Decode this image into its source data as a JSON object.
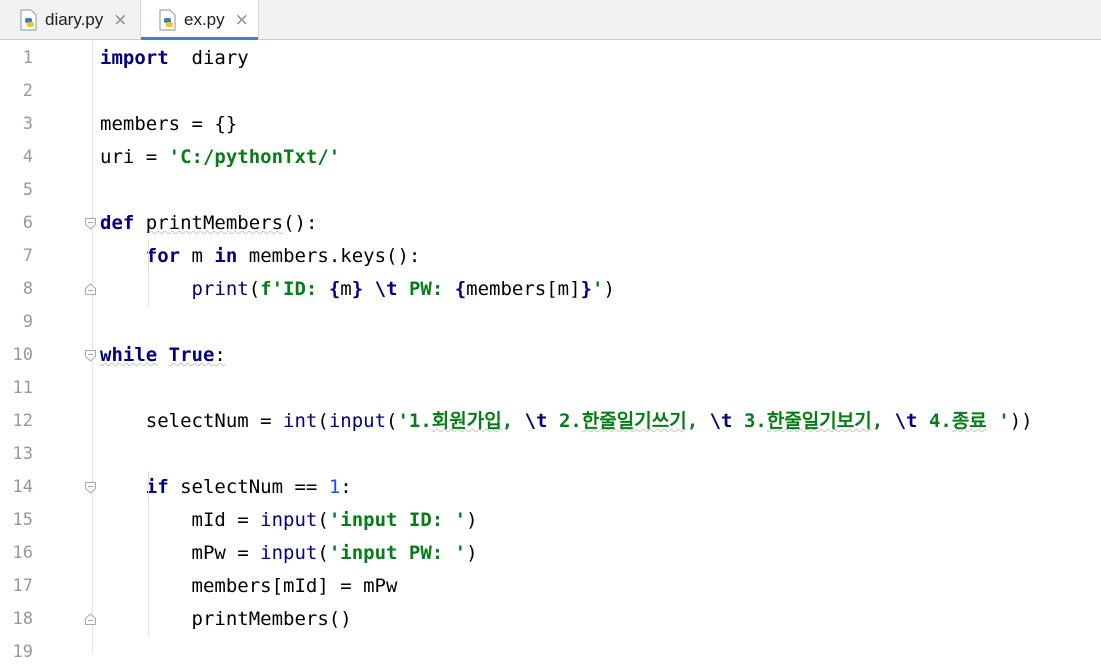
{
  "tabs": [
    {
      "label": "diary.py",
      "icon": "python-file-icon",
      "active": false
    },
    {
      "label": "ex.py",
      "icon": "python-file-icon",
      "active": true
    }
  ],
  "tab_close_glyph": "×",
  "editor": {
    "lines": [
      {
        "num": "1",
        "tokens": [
          [
            "kw",
            "import"
          ],
          [
            "",
            "  diary"
          ]
        ]
      },
      {
        "num": "2",
        "tokens": []
      },
      {
        "num": "3",
        "tokens": [
          [
            "",
            "members = {}"
          ]
        ]
      },
      {
        "num": "4",
        "tokens": [
          [
            "",
            "uri = "
          ],
          [
            "str",
            "'C:/pythonTxt/'"
          ]
        ]
      },
      {
        "num": "5",
        "tokens": []
      },
      {
        "num": "6",
        "tokens": [
          [
            "kw",
            "def"
          ],
          [
            "",
            " "
          ],
          [
            "wavy",
            "printMembers"
          ],
          [
            "",
            "():"
          ]
        ]
      },
      {
        "num": "7",
        "tokens": [
          [
            "",
            "    "
          ],
          [
            "kw",
            "for"
          ],
          [
            "",
            " m "
          ],
          [
            "kw",
            "in"
          ],
          [
            "",
            " members.keys():"
          ]
        ]
      },
      {
        "num": "8",
        "tokens": [
          [
            "",
            "        "
          ],
          [
            "fn",
            "print"
          ],
          [
            "",
            "("
          ],
          [
            "str",
            "f'ID: "
          ],
          [
            "esc",
            "{"
          ],
          [
            "",
            "m"
          ],
          [
            "esc",
            "}"
          ],
          [
            "str",
            " "
          ],
          [
            "esc",
            "\\t"
          ],
          [
            "str",
            " PW: "
          ],
          [
            "esc",
            "{"
          ],
          [
            "",
            "members[m]"
          ],
          [
            "esc",
            "}"
          ],
          [
            "str",
            "'"
          ],
          [
            "",
            ")"
          ]
        ]
      },
      {
        "num": "9",
        "tokens": []
      },
      {
        "num": "10",
        "tokens": [
          [
            "kw wavy",
            "while"
          ],
          [
            "",
            " "
          ],
          [
            "kw wavy",
            "True"
          ],
          [
            "wavy",
            ":"
          ]
        ]
      },
      {
        "num": "11",
        "tokens": []
      },
      {
        "num": "12",
        "tokens": [
          [
            "",
            "    selectNum = "
          ],
          [
            "fn",
            "int"
          ],
          [
            "",
            "("
          ],
          [
            "fn",
            "input"
          ],
          [
            "",
            "("
          ],
          [
            "str",
            "'1."
          ],
          [
            "strw",
            "회원가입"
          ],
          [
            "str",
            ", "
          ],
          [
            "esc",
            "\\t"
          ],
          [
            "str",
            " 2."
          ],
          [
            "strw",
            "한줄일기쓰기"
          ],
          [
            "str",
            ", "
          ],
          [
            "esc",
            "\\t"
          ],
          [
            "str",
            " 3."
          ],
          [
            "strw",
            "한줄일기보기"
          ],
          [
            "str",
            ", "
          ],
          [
            "esc",
            "\\t"
          ],
          [
            "str",
            " 4."
          ],
          [
            "strw",
            "종료"
          ],
          [
            "str",
            " '"
          ],
          [
            "",
            "))"
          ]
        ]
      },
      {
        "num": "13",
        "tokens": []
      },
      {
        "num": "14",
        "tokens": [
          [
            "",
            "    "
          ],
          [
            "kw",
            "if"
          ],
          [
            "",
            " selectNum == "
          ],
          [
            "num",
            "1"
          ],
          [
            "",
            ":"
          ]
        ]
      },
      {
        "num": "15",
        "tokens": [
          [
            "",
            "        mId = "
          ],
          [
            "fn",
            "input"
          ],
          [
            "",
            "("
          ],
          [
            "str",
            "'input ID: '"
          ],
          [
            "",
            ")"
          ]
        ]
      },
      {
        "num": "16",
        "tokens": [
          [
            "",
            "        mPw = "
          ],
          [
            "fn",
            "input"
          ],
          [
            "",
            "("
          ],
          [
            "str",
            "'input PW: '"
          ],
          [
            "",
            ")"
          ]
        ]
      },
      {
        "num": "17",
        "tokens": [
          [
            "",
            "        members[mId] = mPw"
          ]
        ]
      },
      {
        "num": "18",
        "tokens": [
          [
            "",
            "        printMembers()"
          ]
        ]
      },
      {
        "num": "19",
        "tokens": []
      }
    ]
  }
}
